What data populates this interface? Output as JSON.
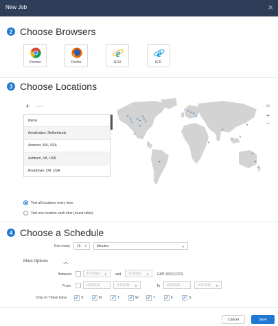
{
  "window": {
    "title": "New Job",
    "close_glyph": "×"
  },
  "sections": {
    "browsers": {
      "number": "2",
      "title": "Choose Browsers"
    },
    "locations": {
      "number": "3",
      "title": "Choose Locations"
    },
    "schedule": {
      "number": "4",
      "title": "Choose a Schedule"
    }
  },
  "browsers": [
    {
      "label": "Chrome",
      "icon": "chrome-icon"
    },
    {
      "label": "Firefox",
      "icon": "firefox-icon"
    },
    {
      "label": "IE10",
      "icon": "ie-icon"
    },
    {
      "label": "IE11",
      "icon": "ie-icon"
    }
  ],
  "locations": {
    "add_glyph": "+",
    "remove_glyph": "—",
    "column_header": "Name",
    "items": [
      "Amsterdam, Netherlands",
      "Andover, MA, USA",
      "Ashburn, VA, USA",
      "Boardman, OR, USA"
    ],
    "map_controls": {
      "home": "⌂",
      "zoom_in": "+",
      "zoom_out": "−"
    },
    "radio_all": "Test all locations every time.",
    "radio_one": "Test one location each time (round robin)",
    "pin_color": "#1f78d1",
    "land_color": "#d3d3d3"
  },
  "schedule": {
    "run_every_label": "Run every",
    "run_every_value": "15",
    "unit": "Minutes",
    "more_options": "More Options",
    "more_options_chevron": "︿",
    "between_label": "Between",
    "between_start": "12:00am",
    "and_label": "and",
    "between_end": "11:00pm",
    "timezone": "GMT-0600 (CST)",
    "from_label": "From",
    "from_date": "02/02/16",
    "from_time": "3:16 PM",
    "to_label": "To",
    "to_date": "02/02/16",
    "to_time": "3:16 PM",
    "days_label": "Only on These Days",
    "days": [
      "S",
      "M",
      "T",
      "W",
      "T",
      "F",
      "S"
    ],
    "check_glyph": "✓"
  },
  "actions": {
    "cancel": "Cancel",
    "save": "Save"
  },
  "colors": {
    "titlebar": "#2e3e58",
    "accent": "#1f78d1"
  }
}
